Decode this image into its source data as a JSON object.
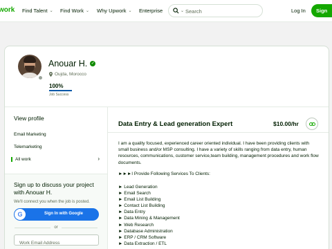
{
  "header": {
    "logo": "work",
    "nav": [
      {
        "label": "Find Talent"
      },
      {
        "label": "Find Work"
      },
      {
        "label": "Why Upwork"
      },
      {
        "label": "Enterprise"
      }
    ],
    "search_placeholder": "Search",
    "login_label": "Log In",
    "signup_label": "Sign"
  },
  "profile": {
    "name": "Anouar H.",
    "location": "Oujda, Morocco",
    "job_success_percent": "100%",
    "job_success_value": 1.0,
    "job_success_label": "Job Success"
  },
  "sidebar": {
    "heading": "View profile",
    "items": [
      {
        "label": "Email Marketing"
      },
      {
        "label": "Telemarketing"
      },
      {
        "label": "All work"
      }
    ],
    "cta": {
      "title": "Sign up to discuss your project with Anouar H.",
      "subtitle": "We'll connect you when the job is posted.",
      "google_label": "Sign In with Google",
      "or_label": "or",
      "email_placeholder": "Work Email Address"
    }
  },
  "main": {
    "title": "Data Entry & Lead generation Expert",
    "rate": "$10.00/hr",
    "description": "I am a quality focused, experienced career oriented individual. I have been providing clients with small business and/or MSP consulting. I have a variety of skills ranging from data entry, human resources, communications, customer service,team building, management procedures and work flow documents.",
    "provide_heading": "►►►I Provide Following Services To Clients:",
    "services": [
      "► Lead Generation",
      "► Email Search",
      "► Email List Building",
      "► Contact List Building",
      "► Data Entry",
      "► Data Mining & Management",
      "► Web Research",
      "► Database Administration",
      "► ERP / CRM Software",
      "► Data Extraction / ETL"
    ]
  },
  "colors": {
    "brand_green": "#14a800",
    "verified_blue": "#0057a8",
    "google_blue": "#1a73e8"
  },
  "icons": [
    "search-icon",
    "chevron-down-icon",
    "verified-icon",
    "location-pin-icon",
    "chevron-right-icon",
    "google-icon",
    "link-icon"
  ]
}
